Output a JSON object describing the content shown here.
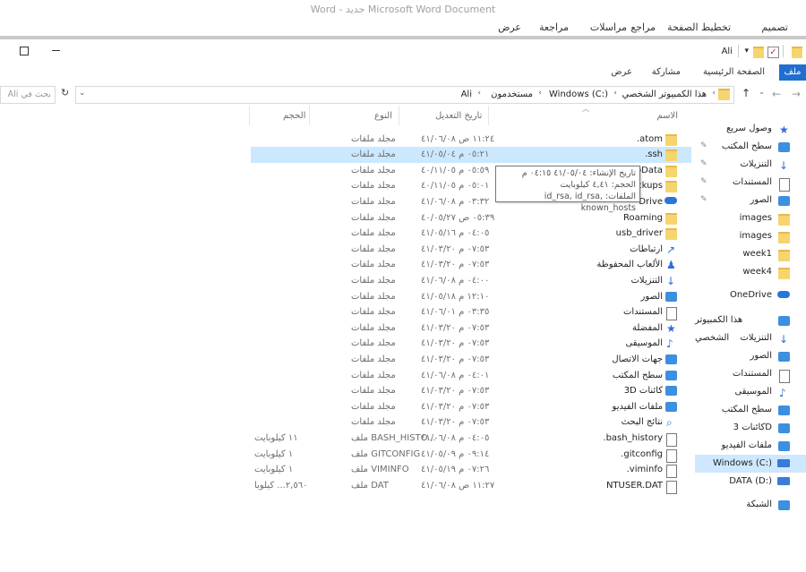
{
  "word": {
    "title": "Word - جديد Microsoft Word Document",
    "tabs": [
      "تصميم",
      "تخطيط الصفحة",
      "مراجع",
      "مراسلات",
      "مراجعة",
      "عرض"
    ]
  },
  "explorer": {
    "title": "Ali",
    "ribbon_tabs": [
      "ملف",
      "الصفحة الرئيسية",
      "مشاركة",
      "عرض"
    ],
    "address": {
      "crumbs": [
        "هذا الكمبيوتر الشخصي",
        "Windows (C:)",
        "مستخدمون",
        "Ali"
      ],
      "search_placeholder": "بحث في Ali",
      "refresh": "↻"
    },
    "columns": {
      "name": "الاسم",
      "date": "تاريخ التعديل",
      "type": "النوع",
      "size": "الحجم"
    },
    "rows": [
      {
        "name": ".atom",
        "date": "١١:٢٤ ص ٤١/٠٦/٠٨",
        "type": "مجلد ملفات",
        "size": ""
      },
      {
        "name": ".ssh",
        "date": "٠٥:٢١ م ٤١/٠٥/٠٤",
        "type": "مجلد ملفات",
        "size": ""
      },
      {
        "name": "pData",
        "date": "٠٥:٥٩ م ٤٠/١١/٠٥",
        "type": "مجلد ملفات",
        "size": ""
      },
      {
        "name": "ckups",
        "date": "٠٥:٠١ م ٤٠/١١/٠٥",
        "type": "مجلد ملفات",
        "size": ""
      },
      {
        "name": "Drive",
        "date": "٠٣:٣٢ م ٤١/٠٦/٠٨",
        "type": "مجلد ملفات",
        "size": ""
      },
      {
        "name": "Roaming",
        "date": "٠٥:٣٩ ص ٤٠/٠٥/٢٧",
        "type": "مجلد ملفات",
        "size": ""
      },
      {
        "name": "usb_driver",
        "date": "٠٤:٠٥ م ٤١/٠٥/١٦",
        "type": "مجلد ملفات",
        "size": ""
      },
      {
        "name": "ارتباطات",
        "date": "٠٧:٥٣ م ٤١/٠٣/٢٠",
        "type": "مجلد ملفات",
        "size": ""
      },
      {
        "name": "الألعاب المحفوظة",
        "date": "٠٧:٥٣ م ٤١/٠٣/٢٠",
        "type": "مجلد ملفات",
        "size": ""
      },
      {
        "name": "التنزيلات",
        "date": "٠٤:٠٠ م ٤١/٠٦/٠٨",
        "type": "مجلد ملفات",
        "size": ""
      },
      {
        "name": "الصور",
        "date": "١٢:١٠ م ٤١/٠٥/١٨",
        "type": "مجلد ملفات",
        "size": ""
      },
      {
        "name": "المستندات",
        "date": "٠٣:٣٥ م ٤١/٠٦/٠١",
        "type": "مجلد ملفات",
        "size": ""
      },
      {
        "name": "المفضلة",
        "date": "٠٧:٥٣ م ٤١/٠٣/٢٠",
        "type": "مجلد ملفات",
        "size": ""
      },
      {
        "name": "الموسيقى",
        "date": "٠٧:٥٣ م ٤١/٠٣/٢٠",
        "type": "مجلد ملفات",
        "size": ""
      },
      {
        "name": "جهات الاتصال",
        "date": "٠٧:٥٣ م ٤١/٠٣/٢٠",
        "type": "مجلد ملفات",
        "size": ""
      },
      {
        "name": "سطح المكتب",
        "date": "٠٤:٠١ م ٤١/٠٦/٠٨",
        "type": "مجلد ملفات",
        "size": ""
      },
      {
        "name": "كائنات 3D",
        "date": "٠٧:٥٣ م ٤١/٠٣/٢٠",
        "type": "مجلد ملفات",
        "size": ""
      },
      {
        "name": "ملفات الفيديو",
        "date": "٠٧:٥٣ م ٤١/٠٣/٢٠",
        "type": "مجلد ملفات",
        "size": ""
      },
      {
        "name": "نتائج البحث",
        "date": "٠٧:٥٣ م ٤١/٠٣/٢٠",
        "type": "مجلد ملفات",
        "size": ""
      },
      {
        "name": ".bash_history",
        "date": "٠٤:٠٥ م ٤١/٠٦/٠٨",
        "type": "ملف BASH_HISTO...",
        "size": "١١ كيلوبايت"
      },
      {
        "name": ".gitconfig",
        "date": "٠٩:١٤ م ٤١/٠٥/٠٩",
        "type": "ملف GITCONFIG",
        "size": "١ كيلوبايت"
      },
      {
        "name": ".viminfo",
        "date": "٠٧:٢٦ م ٤١/٠٥/١٩",
        "type": "ملف VIMINFO",
        "size": "١ كيلوبايت"
      },
      {
        "name": "NTUSER.DAT",
        "date": "١١:٢٧ ص ٤١/٠٦/٠٨",
        "type": "ملف DAT",
        "size": "٢,٥٦٠... كيلوبا"
      }
    ],
    "tooltip": {
      "line1": "تاريخ الإنشاء: ٤١/٠٥/٠٤ ٠٤:١٥ م",
      "line2": "الحجم: ٤,٤١ كيلوبايت",
      "line3": "الملفات: id_rsa, id_rsa, known_hosts"
    },
    "nav": [
      {
        "label": "وصول سريع",
        "pinned": false,
        "icon": "star-icon"
      },
      {
        "label": "سطح المكتب",
        "pinned": true,
        "icon": "desktop-icon"
      },
      {
        "label": "التنزيلات",
        "pinned": true,
        "icon": "download-icon"
      },
      {
        "label": "المستندات",
        "pinned": true,
        "icon": "documents-icon"
      },
      {
        "label": "الصور",
        "pinned": true,
        "icon": "pictures-icon"
      },
      {
        "label": "images",
        "pinned": false,
        "icon": "folder-icon"
      },
      {
        "label": "images",
        "pinned": false,
        "icon": "folder-icon"
      },
      {
        "label": "week1",
        "pinned": false,
        "icon": "folder-icon"
      },
      {
        "label": "week4",
        "pinned": false,
        "icon": "folder-icon"
      },
      {
        "label": "OneDrive",
        "pinned": false,
        "icon": "onedrive-icon"
      },
      {
        "label": "هذا الكمبيوتر الشخصي",
        "pinned": false,
        "icon": "computer-icon"
      },
      {
        "label": "التنزيلات",
        "pinned": false,
        "icon": "download-icon"
      },
      {
        "label": "الصور",
        "pinned": false,
        "icon": "pictures-icon"
      },
      {
        "label": "المستندات",
        "pinned": false,
        "icon": "documents-icon"
      },
      {
        "label": "الموسيقى",
        "pinned": false,
        "icon": "music-icon"
      },
      {
        "label": "سطح المكتب",
        "pinned": false,
        "icon": "desktop-icon"
      },
      {
        "label": "كائنات 3D",
        "pinned": false,
        "icon": "3d-objects-icon"
      },
      {
        "label": "ملفات الفيديو",
        "pinned": false,
        "icon": "video-icon"
      },
      {
        "label": "Windows (C:)",
        "pinned": false,
        "icon": "drive-icon"
      },
      {
        "label": "DATA (D:)",
        "pinned": false,
        "icon": "drive-icon"
      },
      {
        "label": "الشبكة",
        "pinned": false,
        "icon": "network-icon"
      }
    ]
  }
}
